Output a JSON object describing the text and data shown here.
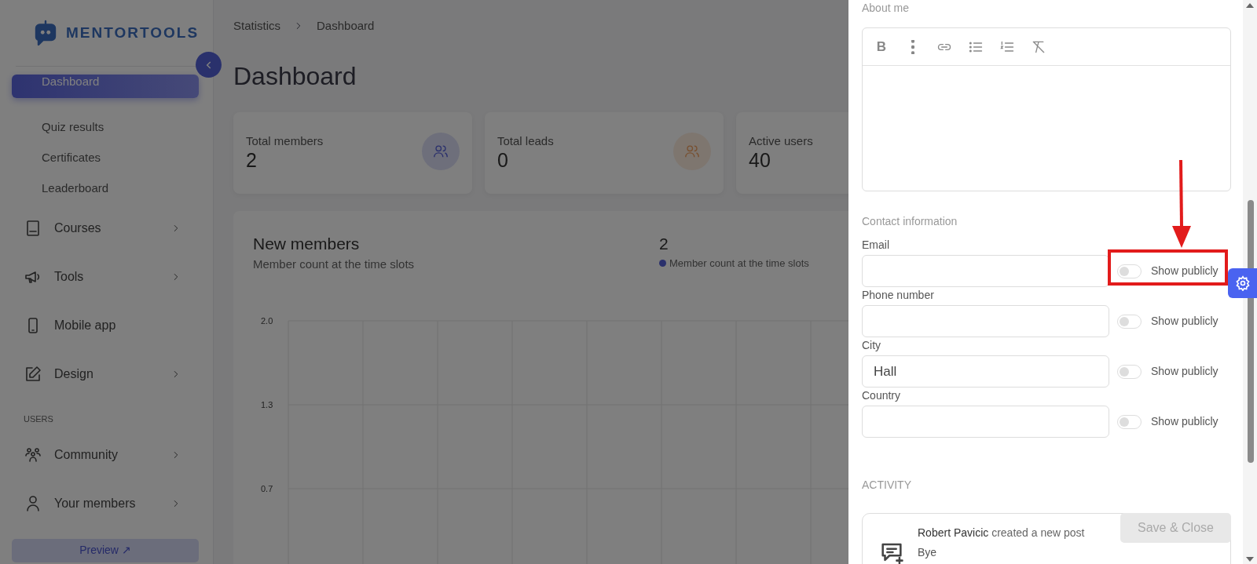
{
  "sidebar": {
    "logo_text": "MENTORTOOLS",
    "items": [
      {
        "kind": "subitem",
        "label": "Dashboard",
        "selected": true
      },
      {
        "kind": "subitem",
        "label": "Quiz results",
        "selected": false
      },
      {
        "kind": "subitem",
        "label": "Certificates",
        "selected": false
      },
      {
        "kind": "subitem",
        "label": "Leaderboard",
        "selected": false
      },
      {
        "kind": "menu",
        "label": "Courses",
        "expandable": true,
        "selected": false
      },
      {
        "kind": "menu",
        "label": "Tools",
        "expandable": true,
        "selected": false
      },
      {
        "kind": "menu",
        "label": "Mobile app",
        "expandable": false,
        "selected": false
      },
      {
        "kind": "menu",
        "label": "Design",
        "expandable": true,
        "selected": false
      },
      {
        "kind": "heading",
        "label": "USERS"
      },
      {
        "kind": "menu",
        "label": "Community",
        "expandable": true,
        "selected": false
      },
      {
        "kind": "menu",
        "label": "Your members",
        "expandable": true,
        "selected": false
      }
    ],
    "preview_button": {
      "label": "Preview ↗"
    }
  },
  "breadcrumb": [
    "Statistics",
    "Dashboard"
  ],
  "page_title": "Dashboard",
  "stats": [
    {
      "label": "Total members",
      "value": "2"
    },
    {
      "label": "Total leads",
      "value": "0"
    },
    {
      "label": "Active users",
      "value": "40"
    }
  ],
  "new_members": {
    "title": "New members",
    "subtitle": "Member count at the time slots",
    "total": "2",
    "legend": {
      "label": "Member count at the time slots"
    },
    "y_tick_labels": [
      "2.0",
      "1.3",
      "0.7"
    ]
  },
  "drawer": {
    "about_label": "About me",
    "editor_toolbar": {
      "bold": "B"
    },
    "contact_heading": "Contact information",
    "fields": [
      {
        "label": "Email",
        "show_publicly": {
          "label": "Show publicly",
          "on": false
        }
      },
      {
        "label": "Phone number",
        "show_publicly": {
          "label": "Show publicly",
          "on": false
        }
      },
      {
        "label": "City",
        "value": "Hall",
        "show_publicly": {
          "label": "Show publicly",
          "on": false
        }
      },
      {
        "label": "Country",
        "show_publicly": {
          "label": "Show publicly",
          "on": false
        }
      }
    ],
    "activity_heading": "ACTIVITY",
    "activity": [
      {
        "author": "Robert Pavicic",
        "action": "created a new post",
        "text": "Bye"
      }
    ],
    "save_button": {
      "label": "Save & Close",
      "disabled": true
    }
  }
}
